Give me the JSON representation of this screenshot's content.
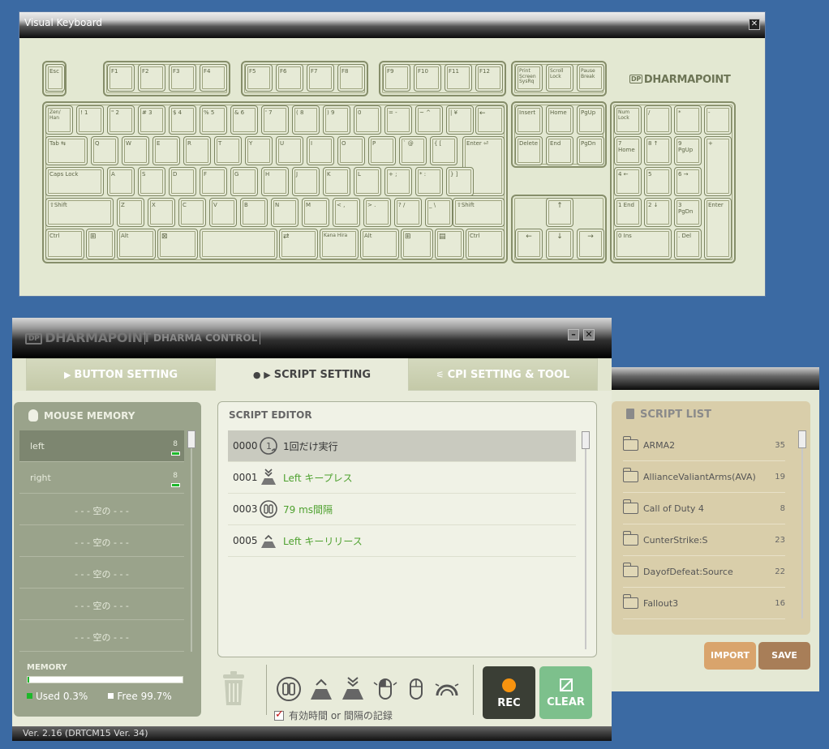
{
  "keyboard_window": {
    "title": "Visual Keyboard",
    "close": "✕",
    "brand": "DHARMAPOINT",
    "brand_mark": "DP"
  },
  "keys": {
    "esc": "Esc",
    "f1": "F1",
    "f2": "F2",
    "f3": "F3",
    "f4": "F4",
    "f5": "F5",
    "f6": "F6",
    "f7": "F7",
    "f8": "F8",
    "f9": "F9",
    "f10": "F10",
    "f11": "F11",
    "f12": "F12",
    "print": "Print Screen SysRq",
    "scroll": "Scroll Lock",
    "pause": "Pause Break",
    "zenhan": "Zen/ Han",
    "backspace": "←",
    "insert": "Insert",
    "home": "Home",
    "pgup": "PgUp",
    "numlock": "Num Lock",
    "slash": "/",
    "star": "*",
    "minus": "-",
    "tab": "Tab ⇆",
    "enter": "Enter ⏎",
    "delete": "Delete",
    "end": "End",
    "pgdn": "PgDn",
    "plus": "+",
    "caps": "Caps Lock",
    "lshift": "⇧Shift",
    "rshift": "⇧Shift",
    "up": "↑",
    "left": "←",
    "down": "↓",
    "right": "→",
    "lctrl": "Ctrl",
    "win": "⊞",
    "alt": "Alt",
    "muhenkan": "⊠",
    "henkan": "⇄",
    "kana": "Kana Hira",
    "ralt": "Alt",
    "rwin": "⊞",
    "menu": "▤",
    "rctrl": "Ctrl",
    "n7": "7 Home",
    "n8": "8 ↑",
    "n9": "9 PgUp",
    "n4": "4 ←",
    "n5": "5",
    "n6": "6 →",
    "n1": "1 End",
    "n2": "2 ↓",
    "n3": "3 PgDn",
    "n0": "0 Ins",
    "ndot": ". Del",
    "nenter": "Enter",
    "row1": [
      "! 1",
      "\" 2",
      "# 3",
      "$ 4",
      "% 5",
      "& 6",
      "' 7",
      "( 8",
      ") 9",
      "0",
      "= -",
      "~ ^",
      "| ¥"
    ],
    "row2": [
      "Q",
      "W",
      "E",
      "R",
      "T",
      "Y",
      "U",
      "I",
      "O",
      "P",
      "` @",
      "{ ["
    ],
    "row3": [
      "A",
      "S",
      "D",
      "F",
      "G",
      "H",
      "J",
      "K",
      "L",
      "+ ;",
      "* :",
      "} ]"
    ],
    "row4": [
      "Z",
      "X",
      "C",
      "V",
      "B",
      "N",
      "M",
      "< ,",
      "> .",
      "? /",
      "_ \\"
    ]
  },
  "main_window": {
    "brand": "DHARMAPOINT",
    "brand_mark": "DP",
    "product": "DHARMA CONTROL",
    "minimize": "–",
    "close": "✕",
    "tabs": [
      {
        "label": "BUTTON SETTING",
        "icon": "▶"
      },
      {
        "label": "SCRIPT SETTING",
        "icon": "● ▶"
      },
      {
        "label": "CPI SETTING & TOOL",
        "icon": "⚟"
      }
    ],
    "status": "Ver. 2.16   (DRTCM15 Ver. 34)"
  },
  "mouse_memory": {
    "title": "MOUSE MEMORY",
    "slots": [
      {
        "label": "left",
        "count": "8"
      },
      {
        "label": "right",
        "count": "8"
      },
      {
        "label": "- - - 空の - - -"
      },
      {
        "label": "- - - 空の - - -"
      },
      {
        "label": "- - - 空の - - -"
      },
      {
        "label": "- - - 空の - - -"
      },
      {
        "label": "- - - 空の - - -"
      }
    ],
    "memory_label": "MEMORY",
    "used_fraction": 0.003,
    "used": "Used 0.3%",
    "free": "Free 99.7%",
    "colors": {
      "used": "#1db82a",
      "free": "#ffffff"
    }
  },
  "script_editor": {
    "title": "SCRIPT EDITOR",
    "rows": [
      {
        "no": "0000",
        "icon": "repeat-once-icon",
        "text": "1回だけ実行"
      },
      {
        "no": "0001",
        "icon": "key-press-icon",
        "text": "Left キープレス"
      },
      {
        "no": "0003",
        "icon": "pause-icon",
        "text": "79 ms間隔"
      },
      {
        "no": "0005",
        "icon": "key-release-icon",
        "text": "Left キーリリース"
      }
    ],
    "record_interval": "有効時間 or 間隔の記録",
    "rec": "REC",
    "clear": "CLEAR"
  },
  "script_list": {
    "title": "SCRIPT LIST",
    "items": [
      {
        "name": "ARMA2",
        "count": "35"
      },
      {
        "name": "AllianceValiantArms(AVA)",
        "count": "19"
      },
      {
        "name": "Call of Duty 4",
        "count": "8"
      },
      {
        "name": "CunterStrike:S",
        "count": "23"
      },
      {
        "name": "DayofDefeat:Source",
        "count": "22"
      },
      {
        "name": "Fallout3",
        "count": "16"
      }
    ],
    "import": "IMPORT",
    "save": "SAVE",
    "colors": {
      "import": "#d9a46c",
      "save": "#a87e58"
    }
  }
}
